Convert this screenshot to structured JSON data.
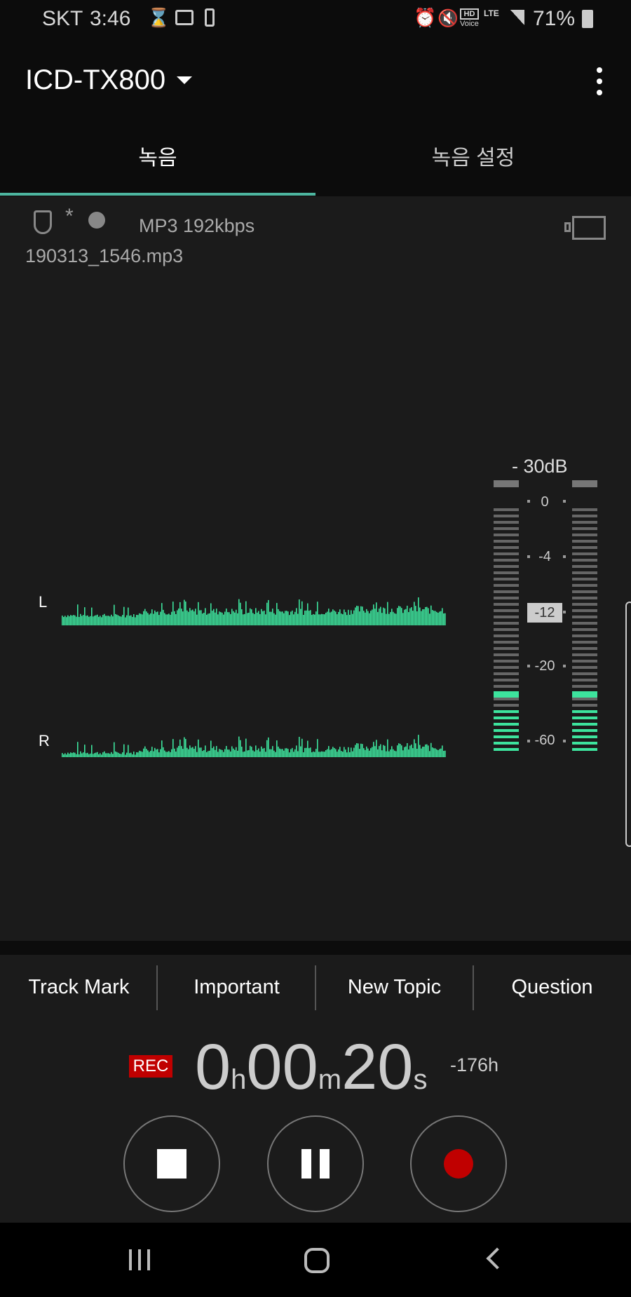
{
  "status_bar": {
    "carrier": "SKT",
    "time": "3:46",
    "battery": "71%",
    "icons": [
      "hourglass-icon",
      "image-icon",
      "nfc-icon",
      "alarm-icon",
      "vibrate-icon",
      "hd-voice-icon",
      "lte-icon",
      "signal-icon",
      "battery-icon"
    ],
    "hd": "HD",
    "voice": "Voice",
    "lte": "LTE"
  },
  "app_bar": {
    "device": "ICD-TX800"
  },
  "tabs": [
    {
      "label": "녹음",
      "active": true
    },
    {
      "label": "녹음 설정",
      "active": false
    }
  ],
  "info": {
    "format": "MP3 192kbps",
    "filename": "190313_1546.mp3"
  },
  "waveform": {
    "left_label": "L",
    "right_label": "R"
  },
  "meter": {
    "sensitivity": "- 30dB",
    "scale": [
      "0",
      "-4",
      "-12",
      "-20",
      "-60"
    ],
    "selected": "-12",
    "lit_segments": 8,
    "peak_segment": 10
  },
  "markers": [
    "Track Mark",
    "Important",
    "New Topic",
    "Question"
  ],
  "timer": {
    "rec": "REC",
    "hours": "0",
    "h": "h",
    "minutes": "00",
    "m": "m",
    "seconds": "20",
    "s": "s",
    "remaining": "-176h"
  },
  "colors": {
    "accent": "#4db6a0",
    "level": "#3de39d",
    "rec": "#c00000"
  }
}
